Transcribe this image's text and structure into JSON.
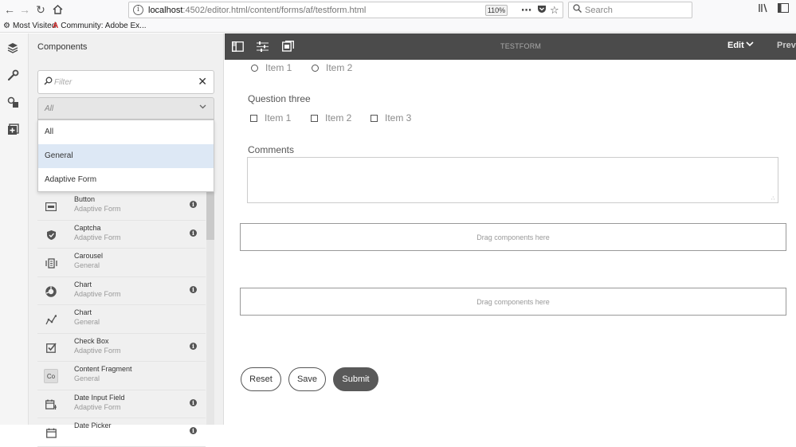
{
  "browser": {
    "url_host": "localhost",
    "url_rest": ":4502/editor.html/content/forms/af/testform.html",
    "zoom": "110%",
    "search_placeholder": "Search",
    "bookmarks": [
      "Most Visited",
      "Community: Adobe Ex..."
    ]
  },
  "components_panel": {
    "title": "Components",
    "filter_placeholder": "Filter",
    "group_select_value": "All",
    "group_options": [
      {
        "label": "All"
      },
      {
        "label": "General"
      },
      {
        "label": "Adaptive Form"
      }
    ],
    "items": [
      {
        "name": "Button",
        "group": "Adaptive Form",
        "icon": "button-icon",
        "info": true
      },
      {
        "name": "Captcha",
        "group": "Adaptive Form",
        "icon": "shield-icon",
        "info": true
      },
      {
        "name": "Carousel",
        "group": "General",
        "icon": "carousel-icon",
        "info": false
      },
      {
        "name": "Chart",
        "group": "Adaptive Form",
        "icon": "donut-chart-icon",
        "info": true
      },
      {
        "name": "Chart",
        "group": "General",
        "icon": "line-chart-icon",
        "info": false
      },
      {
        "name": "Check Box",
        "group": "Adaptive Form",
        "icon": "checkbox-icon",
        "info": true
      },
      {
        "name": "Content Fragment",
        "group": "General",
        "icon": "content-fragment-icon",
        "icon_text": "Co",
        "info": false
      },
      {
        "name": "Date Input Field",
        "group": "Adaptive Form",
        "icon": "calendar-input-icon",
        "info": true
      },
      {
        "name": "Date Picker",
        "group": "",
        "icon": "calendar-icon",
        "info": true
      }
    ]
  },
  "editor": {
    "page_title": "TESTFORM",
    "mode": "Edit",
    "preview_label": "Previ"
  },
  "form": {
    "q2_options": [
      "Item 1",
      "Item 2"
    ],
    "q3_label": "Question three",
    "q3_options": [
      "Item 1",
      "Item 2",
      "Item 3"
    ],
    "comments_label": "Comments",
    "comments_value": "",
    "dropzone_text": "Drag components here",
    "buttons": {
      "reset": "Reset",
      "save": "Save",
      "submit": "Submit"
    }
  }
}
